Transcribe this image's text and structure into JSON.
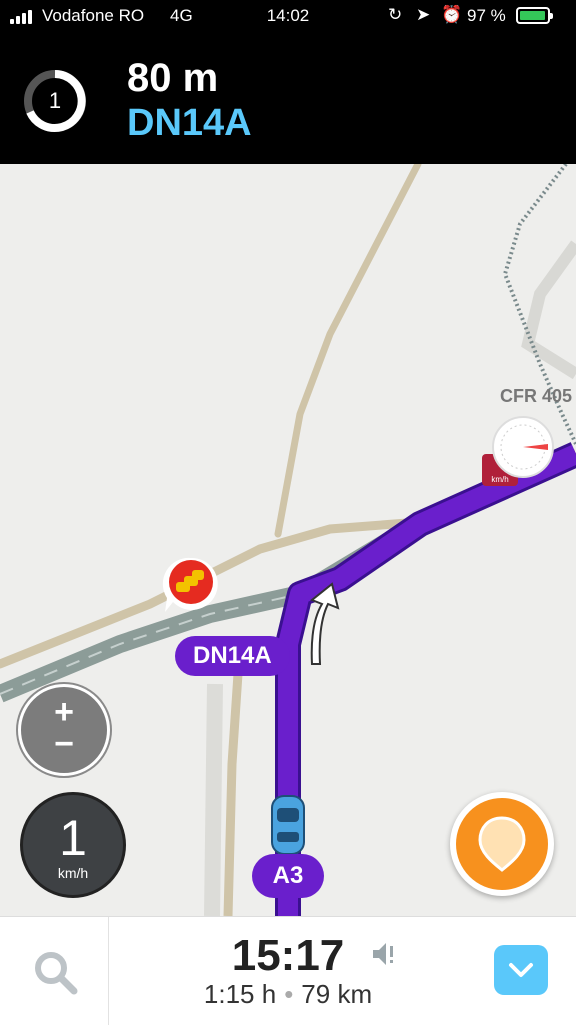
{
  "status": {
    "carrier": "Vodafone RO",
    "network": "4G",
    "time": "14:02",
    "battery_percent": "97 %",
    "battery_level": 0.97,
    "icons": [
      "signal-icon",
      "rotation-lock-icon",
      "location-arrow-icon",
      "alarm-icon",
      "battery-icon"
    ]
  },
  "instruction": {
    "turn_badge": "1",
    "distance": "80 m",
    "street": "DN14A"
  },
  "map": {
    "place_label": "CFR 405",
    "route_label_next": "DN14A",
    "route_label_current": "A3",
    "speed_limit_sign_unit": "km/h",
    "route_color": "#6a1fcc",
    "markers": [
      "traffic-jam-icon",
      "speed-camera-icon",
      "speed-limit-sign-icon",
      "car-position-icon",
      "turn-arrow-icon"
    ]
  },
  "controls": {
    "zoom_in": "+",
    "zoom_out": "−",
    "speed_value": "1",
    "speed_unit": "km/h"
  },
  "bottom": {
    "eta": "15:17",
    "duration": "1:15 h",
    "separator": "•",
    "distance": "79 km",
    "icons": [
      "search-icon",
      "sound-alert-icon",
      "chevron-down-icon",
      "report-pin-icon"
    ]
  }
}
